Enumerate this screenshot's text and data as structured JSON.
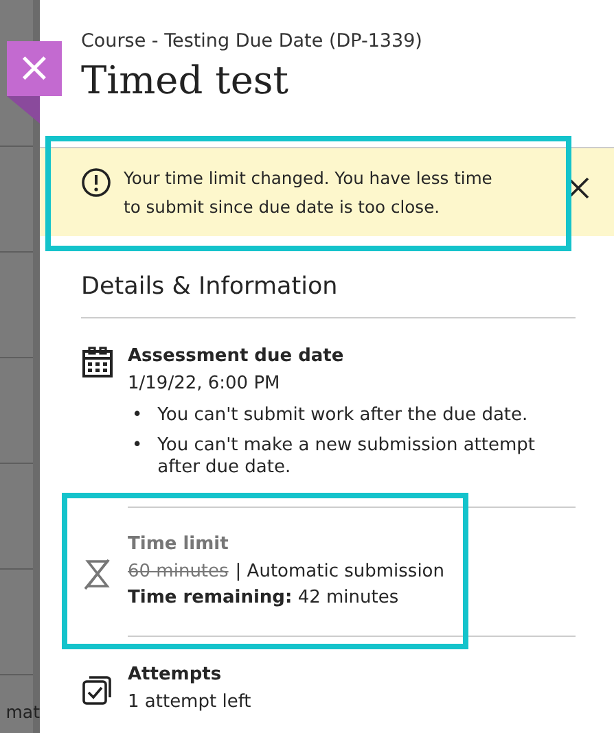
{
  "backdrop": {
    "text": "mat"
  },
  "close_button": {
    "label": "×"
  },
  "course": "Course - Testing Due Date (DP-1339)",
  "title": "Timed test",
  "banner": {
    "message": "Your time limit changed. You have less time to submit since due date is too close.",
    "highlighted": true
  },
  "details": {
    "heading": "Details & Information",
    "items": [
      {
        "kind": "due_date",
        "label": "Assessment due date",
        "value": "1/19/22, 6:00 PM",
        "notes": [
          {
            "marker": "•",
            "text": "You can't submit work after the due date."
          },
          {
            "marker": "•",
            "text": "You can't make a new submission attempt after due date."
          }
        ]
      },
      {
        "kind": "time_limit",
        "label": "Time limit",
        "previous_value": "60 minutes",
        "value": "| Automatic submission",
        "remaining": "**Time remaining:** 42 minutes",
        "highlighted": true
      },
      {
        "kind": "attempts",
        "label": "Attempts",
        "value": "1 attempt left"
      }
    ]
  }
}
